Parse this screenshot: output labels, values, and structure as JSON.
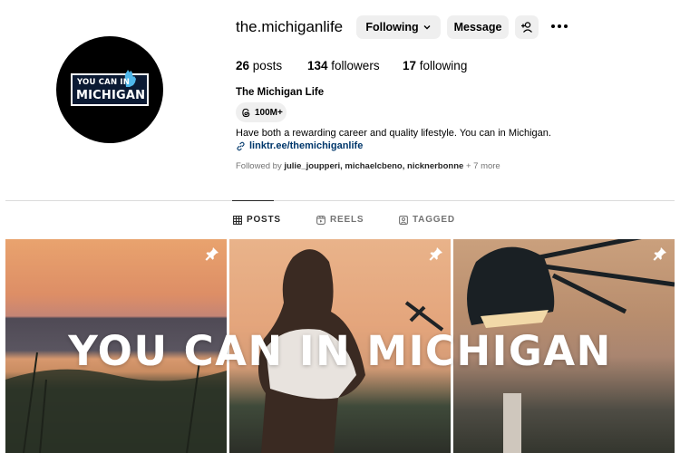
{
  "profile": {
    "username": "the.michiganlife",
    "avatar_logo": {
      "line1": "YOU CAN IN",
      "line2": "MICHIGAN"
    },
    "buttons": {
      "following": "Following",
      "message": "Message"
    },
    "stats": {
      "posts_count": "26",
      "posts_label": "posts",
      "followers_count": "134",
      "followers_label": "followers",
      "following_count": "17",
      "following_label": "following"
    },
    "display_name": "The Michigan Life",
    "threads_count": "100M+",
    "bio": "Have both a rewarding career and quality lifestyle. You can in Michigan.",
    "link": "linktr.ee/themichiganlife",
    "followed_by": {
      "prefix": "Followed by",
      "names": "julie_joupperi, michaelcbeno, nicknerbonne",
      "suffix": "+ 7 more"
    }
  },
  "tabs": [
    {
      "label": "POSTS",
      "icon": "grid-icon",
      "active": true
    },
    {
      "label": "REELS",
      "icon": "reels-icon",
      "active": false
    },
    {
      "label": "TAGGED",
      "icon": "tagged-icon",
      "active": false
    }
  ],
  "grid": {
    "overlay_text": "YOU CAN IN MICHIGAN",
    "posts": [
      {
        "pinned": true,
        "icon": "pin-icon"
      },
      {
        "pinned": true,
        "icon": "pin-icon"
      },
      {
        "pinned": true,
        "icon": "pin-icon"
      }
    ]
  },
  "colors": {
    "link": "#00376b",
    "button_bg": "#efefef",
    "muted_text": "#737373",
    "logo_badge": "#0b1a33"
  }
}
